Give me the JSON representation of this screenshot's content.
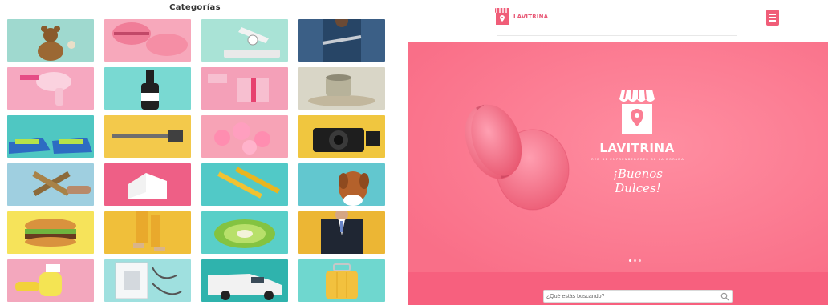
{
  "categories": {
    "title": "Categorías",
    "items": [
      {
        "icon": "teddy-bear-icon",
        "bg": "#9fd9cf"
      },
      {
        "icon": "macaron-icon",
        "bg": "#f7a8bb"
      },
      {
        "icon": "kitchen-scale-icon",
        "bg": "#a9e3d6"
      },
      {
        "icon": "mechanic-icon",
        "bg": "#3b5f86"
      },
      {
        "icon": "hair-dryer-icon",
        "bg": "#f6a8c0"
      },
      {
        "icon": "wine-bottle-icon",
        "bg": "#79d9d2"
      },
      {
        "icon": "gift-icon",
        "bg": "#f4a0b8"
      },
      {
        "icon": "coffee-cup-icon",
        "bg": "#d9d6c7"
      },
      {
        "icon": "sneakers-icon",
        "bg": "#4fc7c2"
      },
      {
        "icon": "hammer-icon",
        "bg": "#f3c94b"
      },
      {
        "icon": "tulips-icon",
        "bg": "#f7a3b6"
      },
      {
        "icon": "camera-icon",
        "bg": "#f0c63f"
      },
      {
        "icon": "cross-plank-icon",
        "bg": "#9fcfe0"
      },
      {
        "icon": "house-model-icon",
        "bg": "#ee5f86"
      },
      {
        "icon": "pencils-icon",
        "bg": "#51c9c7"
      },
      {
        "icon": "dog-icon",
        "bg": "#62c7cf"
      },
      {
        "icon": "burger-icon",
        "bg": "#f6e35a"
      },
      {
        "icon": "legs-icon",
        "bg": "#f0bf3a"
      },
      {
        "icon": "kiwi-icon",
        "bg": "#59cfc8"
      },
      {
        "icon": "businessman-icon",
        "bg": "#ecb634"
      },
      {
        "icon": "spray-bottle-icon",
        "bg": "#f3a7bd"
      },
      {
        "icon": "electrical-panel-icon",
        "bg": "#9fe0df"
      },
      {
        "icon": "van-icon",
        "bg": "#2fb3ad"
      },
      {
        "icon": "suitcase-icon",
        "bg": "#6fd7cf"
      }
    ]
  },
  "site": {
    "logo_text": "LAVITRINA",
    "menu_icon": "hamburger-icon",
    "hero": {
      "brand": "LAVITRINA",
      "tagline": "RED DE EMPRENDEDORES DE LA DORADA",
      "greeting": "¡Buenos Dulces!",
      "slide_count": 3,
      "active_slide": 0
    },
    "search": {
      "placeholder": "¿Qué estás buscando?"
    }
  },
  "colors": {
    "brand": "#f05d78",
    "hero_bg": "#fb7e93",
    "band": "#f7607e"
  }
}
